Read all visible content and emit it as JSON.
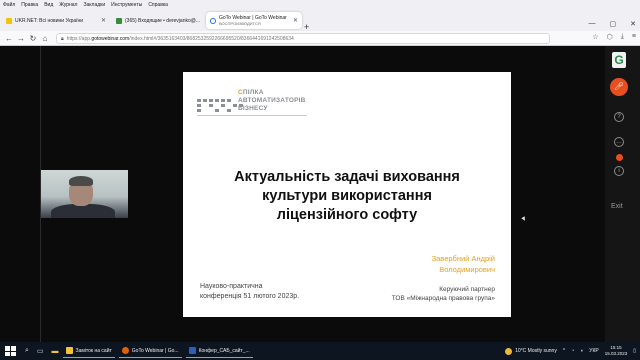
{
  "menubar": [
    "Файл",
    "Правка",
    "Вид",
    "Журнал",
    "Закладки",
    "Инструменты",
    "Справка"
  ],
  "tabs": [
    {
      "label": "UKR.NET: Всі новини України",
      "fav_color": "#f5c400"
    },
    {
      "label": "(365) Входящие • derevjanko@...",
      "fav_color": "#2f8f3a"
    },
    {
      "label": "GoTo Webinar | GoTo Webinar",
      "sub": "ВОСПРОИЗВОДИТСЯ",
      "fav_color": "#1a73e8"
    }
  ],
  "newtab": "+",
  "window_controls": {
    "minimize": "—",
    "maximize": "▢",
    "close": "✕"
  },
  "nav": {
    "back": "←",
    "forward": "→",
    "reload": "↻",
    "home": "⌂"
  },
  "url": {
    "prefix": "https://app.",
    "domain": "gotowebinar.com",
    "rest": "/index.html#/3635163403/8682532592266695520/8366441691242508634"
  },
  "nav_right": [
    "☆",
    "⬡",
    "⤓",
    "≡"
  ],
  "slide": {
    "logo_line1": "СПІЛКА",
    "logo_line2": "АВТОМАТИЗАТОРІВ",
    "logo_line3": "БІЗНЕСУ",
    "title_line1": "Актуальність задачі виховання",
    "title_line2": "культури використання",
    "title_line3": "ліцензійного софту",
    "author_line1": "Завербний Андрій",
    "author_line2": "Володимирович",
    "conf_line1": "Науково-практична",
    "conf_line2": "конференція 51 лютого 2023р.",
    "role_line1": "Керуючий партнер",
    "role_line2": "ТОВ «Міжнародна правова група»"
  },
  "side_panel": {
    "logo": "G",
    "exit": "Exit"
  },
  "taskbar": {
    "apps": [
      {
        "label": "Заміток на сайт",
        "color": "#f3c238"
      },
      {
        "label": "GoTo Webinar | Go...",
        "color": "#e66000"
      },
      {
        "label": "Конфер_САБ_сайт_...",
        "color": "#2b5ebd"
      }
    ],
    "weather": "10°C  Mostly sunny",
    "lang": "УКР",
    "time": "15:15",
    "date": "15.03.2023"
  },
  "colors": {
    "accent": "#e7a11f",
    "gtw_orange": "#e84f1e",
    "gtw_green": "#2a8a4c"
  }
}
